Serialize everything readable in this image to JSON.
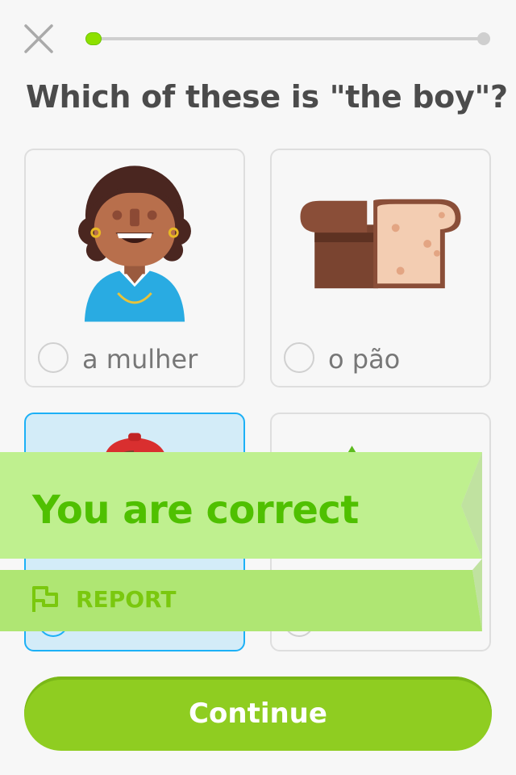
{
  "header": {
    "close_icon": "close-icon",
    "progress_fraction": 0.04
  },
  "question": {
    "text": "Which of these is \"the boy\"?"
  },
  "options": [
    {
      "label": "a mulher",
      "icon": "woman-illustration",
      "selected": false
    },
    {
      "label": "o pão",
      "icon": "bread-illustration",
      "selected": false
    },
    {
      "label": "",
      "icon": "boy-illustration",
      "selected": true
    },
    {
      "label": "",
      "icon": "apple-illustration",
      "selected": false
    }
  ],
  "feedback": {
    "title": "You are correct",
    "report_label": "REPORT",
    "report_icon": "flag-icon",
    "colors": {
      "banner": "#bff08f",
      "banner_lower": "#afe673",
      "title": "#4fc000",
      "report": "#7ac80e"
    }
  },
  "footer": {
    "continue_label": "Continue",
    "color": "#8fcd21"
  },
  "colors": {
    "selected_border": "#1cb0f6",
    "selected_bg": "#d3ecf8"
  }
}
